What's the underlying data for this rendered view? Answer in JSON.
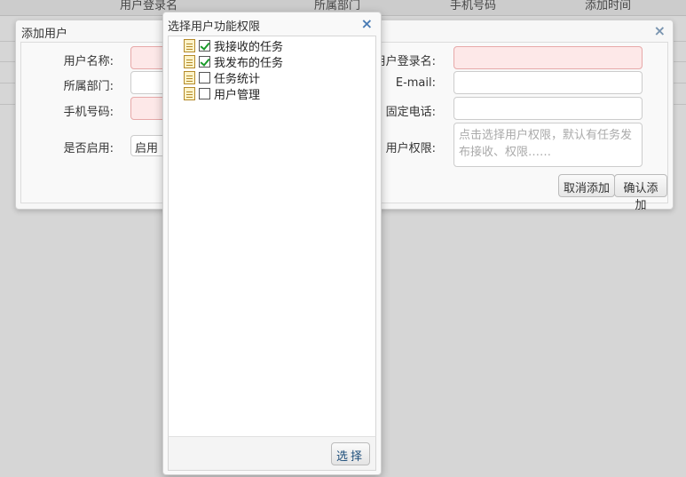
{
  "background_table": {
    "columns": [
      "用户登录名",
      "所属部门",
      "手机号码",
      "添加时间"
    ]
  },
  "add_user_dialog": {
    "title": "添加用户",
    "close_icon": "close-icon",
    "fields": {
      "username_label": "用户名称:",
      "login_label": "用户登录名:",
      "dept_label": "所属部门:",
      "email_label": "E-mail:",
      "mobile_label": "手机号码:",
      "phone_label": "固定电话:",
      "enabled_label": "是否启用:",
      "enabled_value": "启用",
      "perm_label": "用户权限:",
      "perm_placeholder": "点击选择用户权限，默认有任务发布接收、权限……"
    },
    "buttons": {
      "cancel": "取消添加",
      "confirm": "确认添加"
    }
  },
  "permission_dialog": {
    "title": "选择用户功能权限",
    "close_icon": "close-icon",
    "items": [
      {
        "label": "我接收的任务",
        "checked": true
      },
      {
        "label": "我发布的任务",
        "checked": true
      },
      {
        "label": "任务统计",
        "checked": false
      },
      {
        "label": "用户管理",
        "checked": false
      }
    ],
    "select_button": "选择"
  },
  "colors": {
    "required_bg": "#fde8e8",
    "close_icon": "#4a7cb5",
    "check": "#1a9a2a"
  }
}
